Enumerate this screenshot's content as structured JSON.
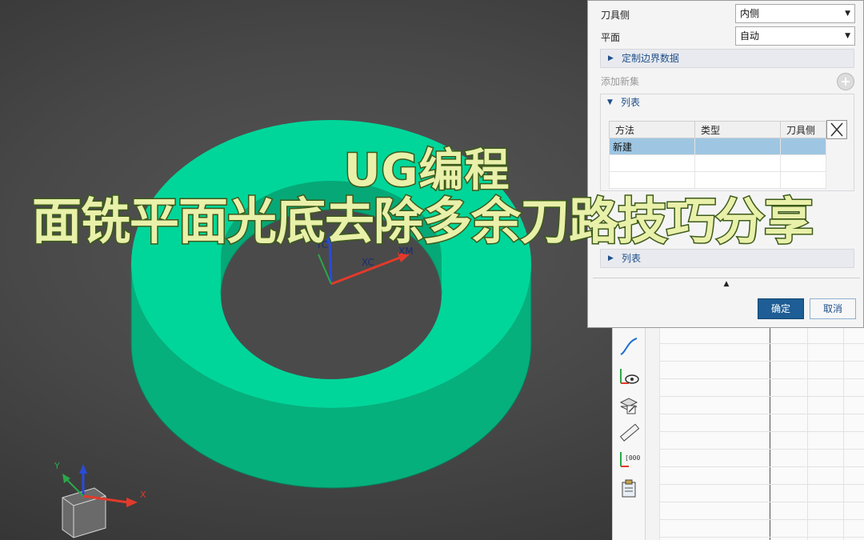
{
  "overlay": {
    "title_line1": "UG编程",
    "title_line2": "面铣平面光底去除多余刀路技巧分享"
  },
  "viewport": {
    "axis_labels": {
      "yc": "YC",
      "xc": "XC",
      "xm": "XM",
      "triad_x": "X",
      "triad_y": "Y"
    },
    "colors": {
      "part_top": "#00d69a",
      "part_side": "#06b07d",
      "x_axis": "#e23a2a",
      "y_axis": "#2a4bd8",
      "z_axis": "#2aa84a"
    }
  },
  "dialog": {
    "tool_side": {
      "label": "刀具侧",
      "value": "内侧"
    },
    "plane": {
      "label": "平面",
      "value": "自动"
    },
    "custom_boundary_section": "定制边界数据",
    "add_new_set": "添加新集",
    "list_section": "列表",
    "table": {
      "columns": [
        "方法",
        "类型",
        "刀具侧"
      ],
      "rows": [
        [
          "新建",
          "",
          ""
        ],
        [
          "",
          "",
          ""
        ],
        [
          "",
          "",
          ""
        ]
      ]
    },
    "list_section_collapsed": "列表",
    "ok": "确定",
    "cancel": "取消",
    "accent": "#1e5d95"
  },
  "toolstrip": {
    "icons": [
      "curve-icon",
      "axis-eye-icon",
      "layer-edit-icon",
      "ruler-icon",
      "axis-numeric-icon",
      "clipboard-icon"
    ]
  }
}
